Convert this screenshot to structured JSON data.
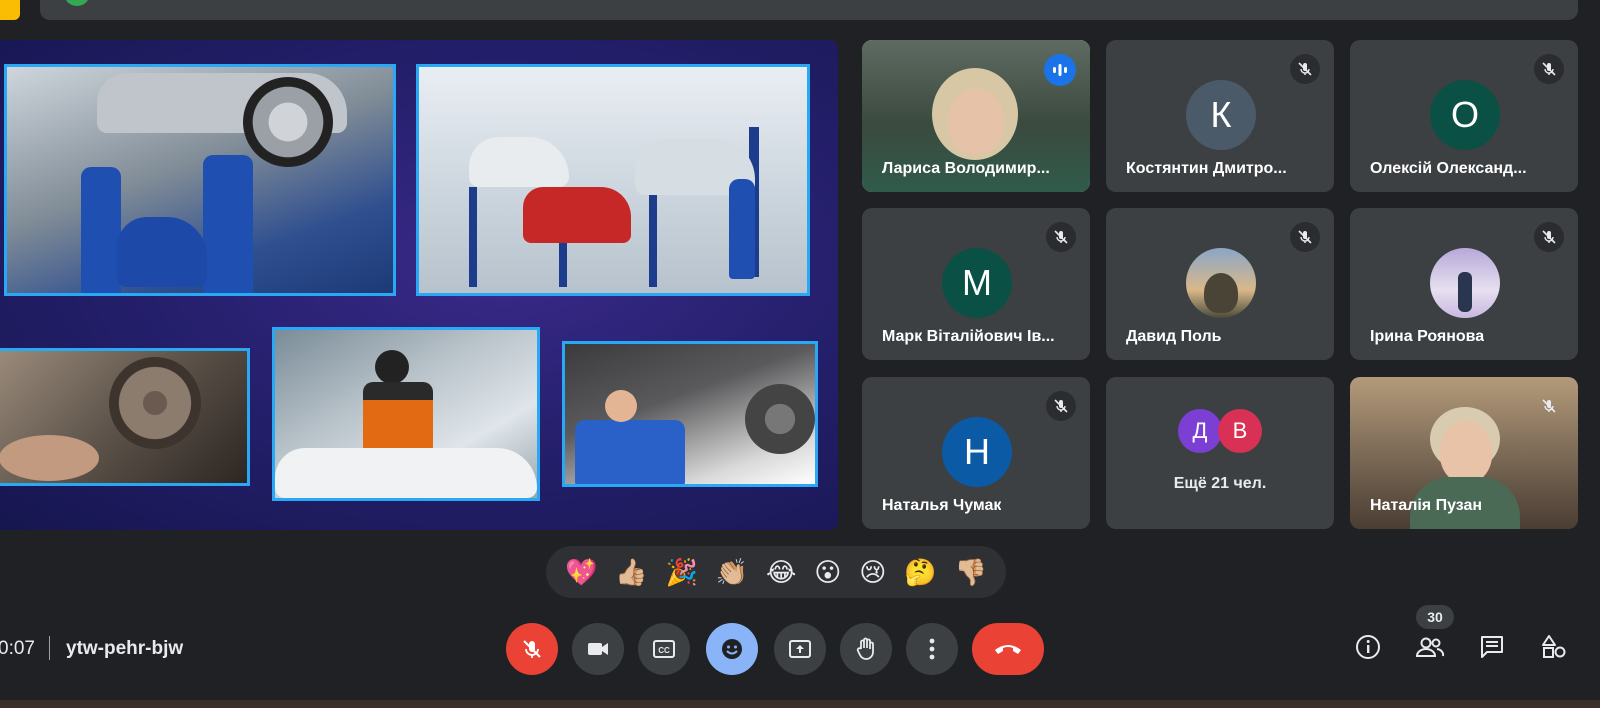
{
  "window": {
    "accent_colors": {
      "mic_off_red": "#ea4335",
      "active_blue": "#8ab4f8",
      "tile_bg": "#3c4043",
      "page_bg": "#202124"
    }
  },
  "presentation": {
    "photos": [
      {
        "icon": "car-lift-workshop-image"
      },
      {
        "icon": "service-center-hall-image"
      },
      {
        "icon": "brake-disc-repair-image"
      },
      {
        "icon": "engine-repair-image"
      },
      {
        "icon": "suspension-repair-image"
      }
    ]
  },
  "participants": [
    {
      "name": "Лариса Володимир...",
      "type": "video",
      "speaking": true
    },
    {
      "name": "Костянтин Дмитро...",
      "initial": "К",
      "avatar_color": "#4a5a68",
      "muted": true
    },
    {
      "name": "Олексій Олександ...",
      "initial": "О",
      "avatar_color": "#0b5044",
      "muted": true
    },
    {
      "name": "Марк Віталійович Ів...",
      "initial": "М",
      "avatar_color": "#0b5044",
      "muted": true
    },
    {
      "name": "Давид Поль",
      "type": "photo",
      "muted": true
    },
    {
      "name": "Ірина Роянова",
      "type": "photo",
      "muted": true
    },
    {
      "name": "Наталья Чумак",
      "initial": "Н",
      "avatar_color": "#0b5aa6",
      "muted": true
    },
    {
      "more": "Ещё 21 чел.",
      "initials": [
        "Д",
        "В"
      ],
      "colors": [
        "#7b3fd3",
        "#d93056"
      ]
    },
    {
      "name": "Наталія Пузан",
      "type": "video",
      "muted": true
    }
  ],
  "reactions": [
    "💖",
    "👍🏼",
    "🎉",
    "👏🏼",
    "😂",
    "😮",
    "😢",
    "🤔",
    "👎🏼"
  ],
  "bottom_bar": {
    "time": "0:07",
    "meeting_code": "ytw-pehr-bjw",
    "participant_count": "30",
    "controls": [
      "mic-off",
      "camera",
      "captions",
      "emoji",
      "present",
      "raise-hand",
      "more-options",
      "leave-call"
    ],
    "right_controls": [
      "meeting-info",
      "people",
      "chat",
      "activities"
    ]
  }
}
